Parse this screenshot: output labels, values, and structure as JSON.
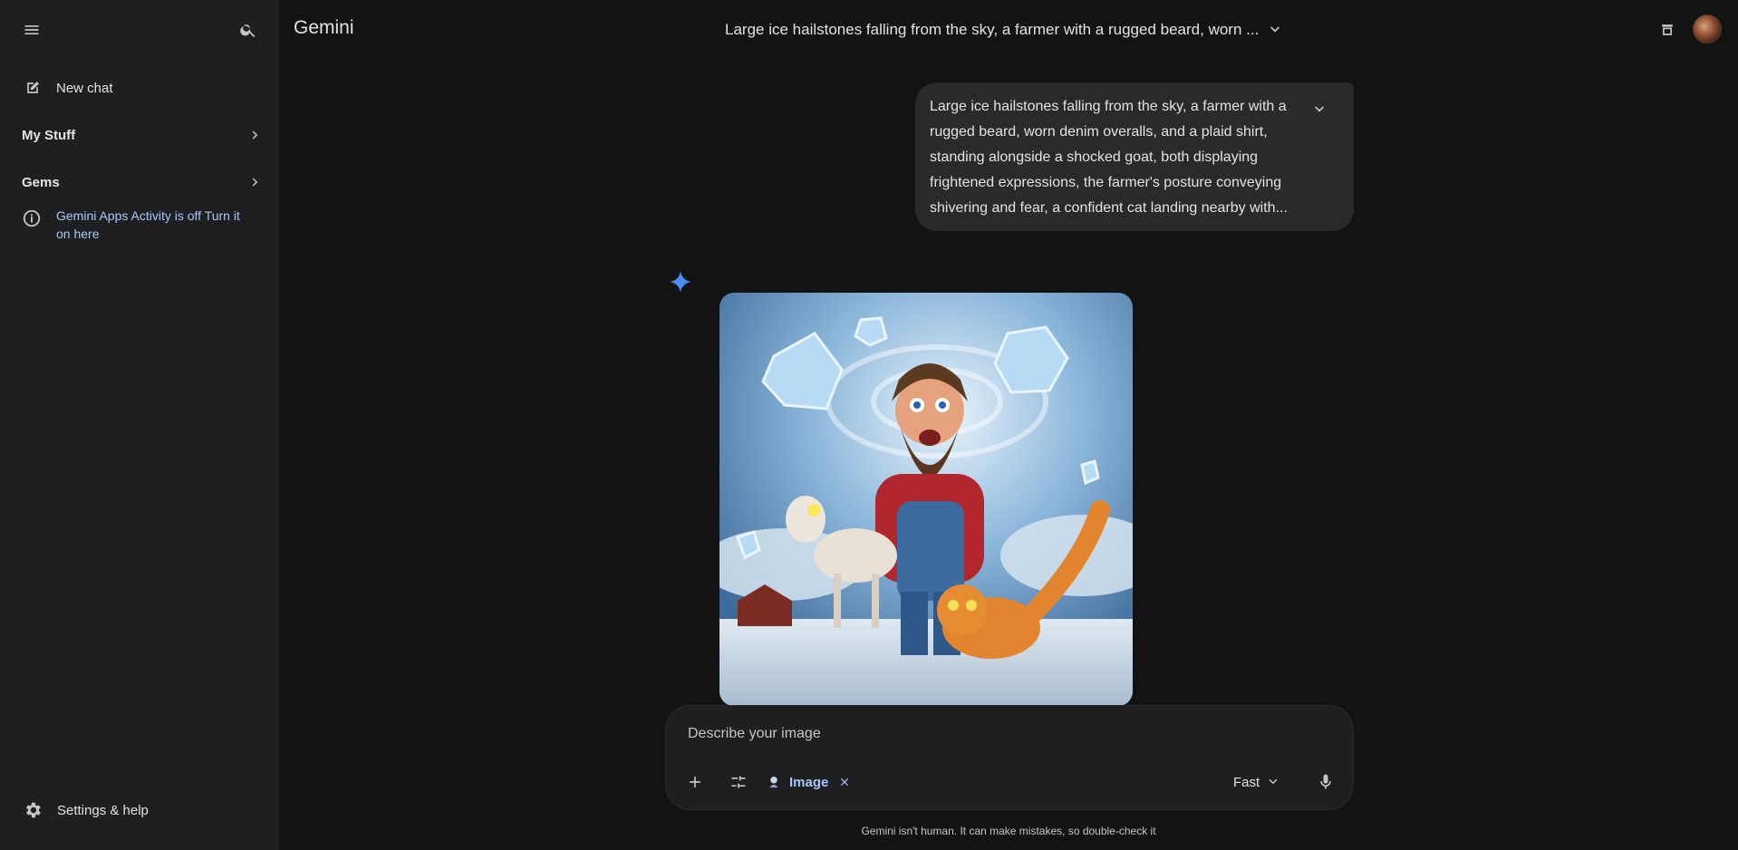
{
  "app": {
    "brand": "Gemini"
  },
  "sidebar": {
    "new_chat_label": "New chat",
    "sections": [
      {
        "label": "My Stuff"
      },
      {
        "label": "Gems"
      }
    ],
    "activity_notice": "Gemini Apps Activity is off Turn it on here",
    "settings_label": "Settings & help"
  },
  "header": {
    "chat_title": "Large ice hailstones falling from the sky, a farmer with a rugged beard, worn ..."
  },
  "conversation": {
    "user_prompt": "Large ice hailstones falling from the sky, a farmer with a rugged beard, worn denim overalls, and a plaid shirt, standing alongside a shocked goat, both displaying frightened expressions, the farmer's posture conveying shivering and fear, a confident cat landing nearby with..."
  },
  "composer": {
    "placeholder": "Describe your image",
    "chip_label": "Image",
    "mode_label": "Fast"
  },
  "footer": {
    "disclaimer": "Gemini isn't human. It can make mistakes, so double-check it"
  },
  "icons": {
    "menu": "menu-icon",
    "search": "search-icon",
    "new_chat": "edit-icon",
    "info": "info-icon",
    "settings": "gear-icon",
    "temp_chat": "temporary-chat-icon",
    "spark": "gemini-spark-icon",
    "plus": "plus-icon",
    "tools": "tune-icon",
    "mic": "mic-icon"
  },
  "colors": {
    "background": "#131314",
    "sidebar": "#1e1f20",
    "bubble": "#282a2c",
    "link": "#a8c7fa",
    "spark": "#4a8df8"
  }
}
